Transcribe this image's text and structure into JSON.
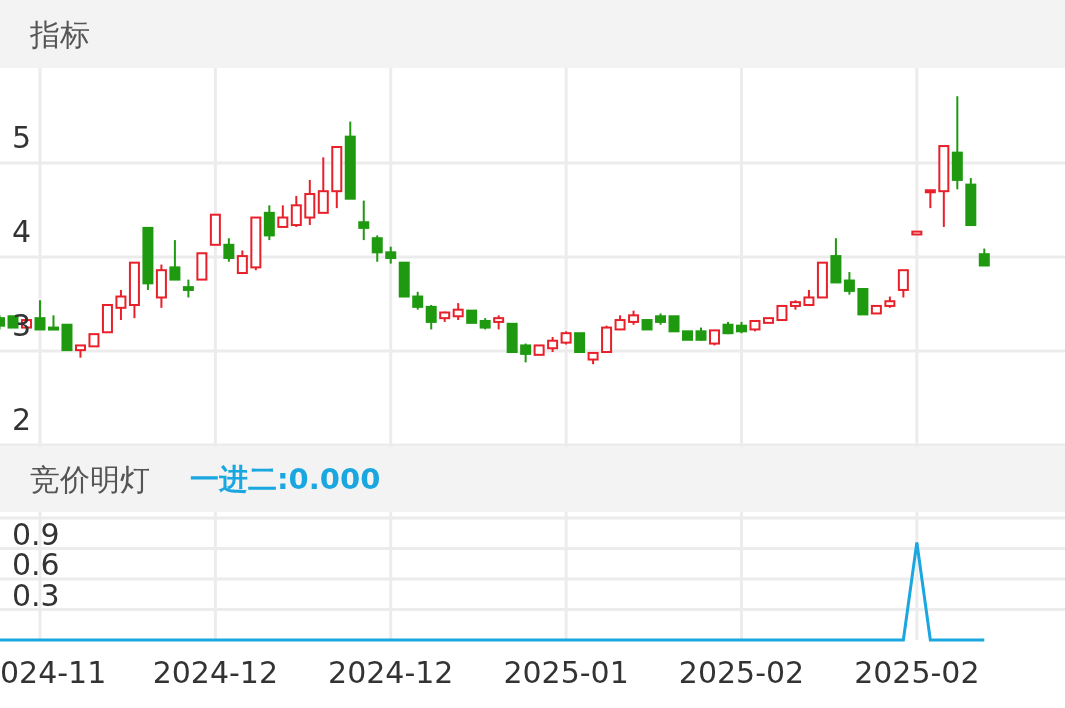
{
  "header": {
    "title": "指标"
  },
  "price_chart": {
    "chart_data": {
      "type": "candlestick",
      "grid": true,
      "yticks": [
        2,
        3,
        4,
        5
      ],
      "ylim": [
        1.98,
        6.01
      ],
      "ohlc": [
        [
          3.35,
          3.38,
          3.23,
          3.27
        ],
        [
          3.37,
          3.37,
          3.25,
          3.25
        ],
        [
          3.25,
          3.33,
          3.25,
          3.33
        ],
        [
          3.35,
          3.54,
          3.23,
          3.23
        ],
        [
          3.25,
          3.38,
          3.23,
          3.23
        ],
        [
          3.28,
          3.28,
          3.01,
          3.01
        ],
        [
          3.01,
          3.06,
          2.93,
          3.06
        ],
        [
          3.05,
          3.18,
          3.05,
          3.18
        ],
        [
          3.2,
          3.49,
          3.2,
          3.49
        ],
        [
          3.46,
          3.65,
          3.33,
          3.58
        ],
        [
          3.49,
          3.94,
          3.35,
          3.94
        ],
        [
          4.31,
          4.31,
          3.65,
          3.72
        ],
        [
          3.57,
          3.92,
          3.46,
          3.86
        ],
        [
          3.89,
          4.18,
          3.76,
          3.76
        ],
        [
          3.68,
          3.76,
          3.57,
          3.65
        ],
        [
          3.76,
          4.04,
          3.76,
          4.04
        ],
        [
          4.13,
          4.45,
          4.13,
          4.45
        ],
        [
          4.13,
          4.2,
          3.95,
          3.99
        ],
        [
          3.83,
          4.07,
          3.83,
          4.01
        ],
        [
          3.89,
          4.42,
          3.86,
          4.42
        ],
        [
          4.47,
          4.55,
          4.18,
          4.23
        ],
        [
          4.32,
          4.55,
          4.32,
          4.42
        ],
        [
          4.34,
          4.65,
          4.32,
          4.55
        ],
        [
          4.42,
          4.82,
          4.34,
          4.67
        ],
        [
          4.47,
          5.06,
          4.47,
          4.7
        ],
        [
          4.7,
          5.17,
          4.52,
          5.17
        ],
        [
          5.28,
          5.44,
          4.62,
          4.62
        ],
        [
          4.37,
          4.6,
          4.18,
          4.31
        ],
        [
          4.2,
          4.23,
          3.95,
          4.05
        ],
        [
          4.05,
          4.11,
          3.93,
          3.99
        ],
        [
          3.94,
          3.94,
          3.58,
          3.58
        ],
        [
          3.58,
          3.63,
          3.44,
          3.47
        ],
        [
          3.47,
          3.49,
          3.23,
          3.31
        ],
        [
          3.35,
          3.42,
          3.31,
          3.41
        ],
        [
          3.37,
          3.51,
          3.33,
          3.44
        ],
        [
          3.43,
          3.43,
          3.3,
          3.3
        ],
        [
          3.32,
          3.35,
          3.23,
          3.25
        ],
        [
          3.31,
          3.38,
          3.23,
          3.35
        ],
        [
          3.29,
          3.29,
          2.99,
          2.99
        ],
        [
          3.06,
          3.08,
          2.88,
          2.97
        ],
        [
          2.96,
          3.06,
          2.96,
          3.06
        ],
        [
          3.03,
          3.15,
          2.99,
          3.11
        ],
        [
          3.09,
          3.21,
          3.07,
          3.19
        ],
        [
          3.19,
          3.19,
          2.99,
          2.99
        ],
        [
          2.91,
          2.98,
          2.86,
          2.98
        ],
        [
          2.99,
          3.27,
          2.99,
          3.25
        ],
        [
          3.23,
          3.38,
          3.23,
          3.33
        ],
        [
          3.31,
          3.43,
          3.28,
          3.38
        ],
        [
          3.33,
          3.33,
          3.23,
          3.23
        ],
        [
          3.37,
          3.4,
          3.28,
          3.31
        ],
        [
          3.37,
          3.37,
          3.21,
          3.21
        ],
        [
          3.21,
          3.21,
          3.12,
          3.12
        ],
        [
          3.21,
          3.25,
          3.11,
          3.12
        ],
        [
          3.08,
          3.22,
          3.06,
          3.22
        ],
        [
          3.28,
          3.31,
          3.18,
          3.19
        ],
        [
          3.27,
          3.31,
          3.19,
          3.21
        ],
        [
          3.23,
          3.33,
          3.21,
          3.32
        ],
        [
          3.3,
          3.35,
          3.3,
          3.35
        ],
        [
          3.33,
          3.48,
          3.33,
          3.48
        ],
        [
          3.48,
          3.54,
          3.44,
          3.52
        ],
        [
          3.49,
          3.65,
          3.49,
          3.57
        ],
        [
          3.57,
          3.94,
          3.57,
          3.94
        ],
        [
          4.01,
          4.2,
          3.73,
          3.73
        ],
        [
          3.75,
          3.84,
          3.6,
          3.64
        ],
        [
          3.66,
          3.66,
          3.39,
          3.39
        ],
        [
          3.4,
          3.48,
          3.4,
          3.48
        ],
        [
          3.48,
          3.58,
          3.46,
          3.53
        ],
        [
          3.65,
          3.86,
          3.57,
          3.86
        ],
        [
          4.24,
          4.27,
          4.24,
          4.27
        ],
        [
          4.69,
          4.71,
          4.52,
          4.71
        ],
        [
          4.7,
          5.18,
          4.32,
          5.18
        ],
        [
          5.11,
          5.71,
          4.72,
          4.82
        ],
        [
          4.77,
          4.84,
          4.34,
          4.34
        ],
        [
          4.03,
          4.09,
          3.91,
          3.91
        ]
      ]
    }
  },
  "indicator_bar": {
    "name": "竞价明灯",
    "reading": "一进二:0.000"
  },
  "indicator_chart": {
    "chart_data": {
      "type": "line",
      "grid": true,
      "yticks": [
        0.3,
        0.6,
        0.9
      ],
      "ylim": [
        0,
        1.26
      ],
      "series": [
        {
          "color": "#1aa7e0",
          "values": [
            0,
            0,
            0,
            0,
            0,
            0,
            0,
            0,
            0,
            0,
            0,
            0,
            0,
            0,
            0,
            0,
            0,
            0,
            0,
            0,
            0,
            0,
            0,
            0,
            0,
            0,
            0,
            0,
            0,
            0,
            0,
            0,
            0,
            0,
            0,
            0,
            0,
            0,
            0,
            0,
            0,
            0,
            0,
            0,
            0,
            0,
            0,
            0,
            0,
            0,
            0,
            0,
            0,
            0,
            0,
            0,
            0,
            0,
            0,
            0,
            0,
            0,
            0,
            0,
            0,
            0,
            0,
            0,
            0.96,
            0,
            0,
            0,
            0,
            0
          ]
        }
      ]
    }
  },
  "x_axis": {
    "labels": [
      "024-11",
      "2024-12",
      "2024-12",
      "2025-01",
      "2025-02",
      "2025-02"
    ]
  }
}
